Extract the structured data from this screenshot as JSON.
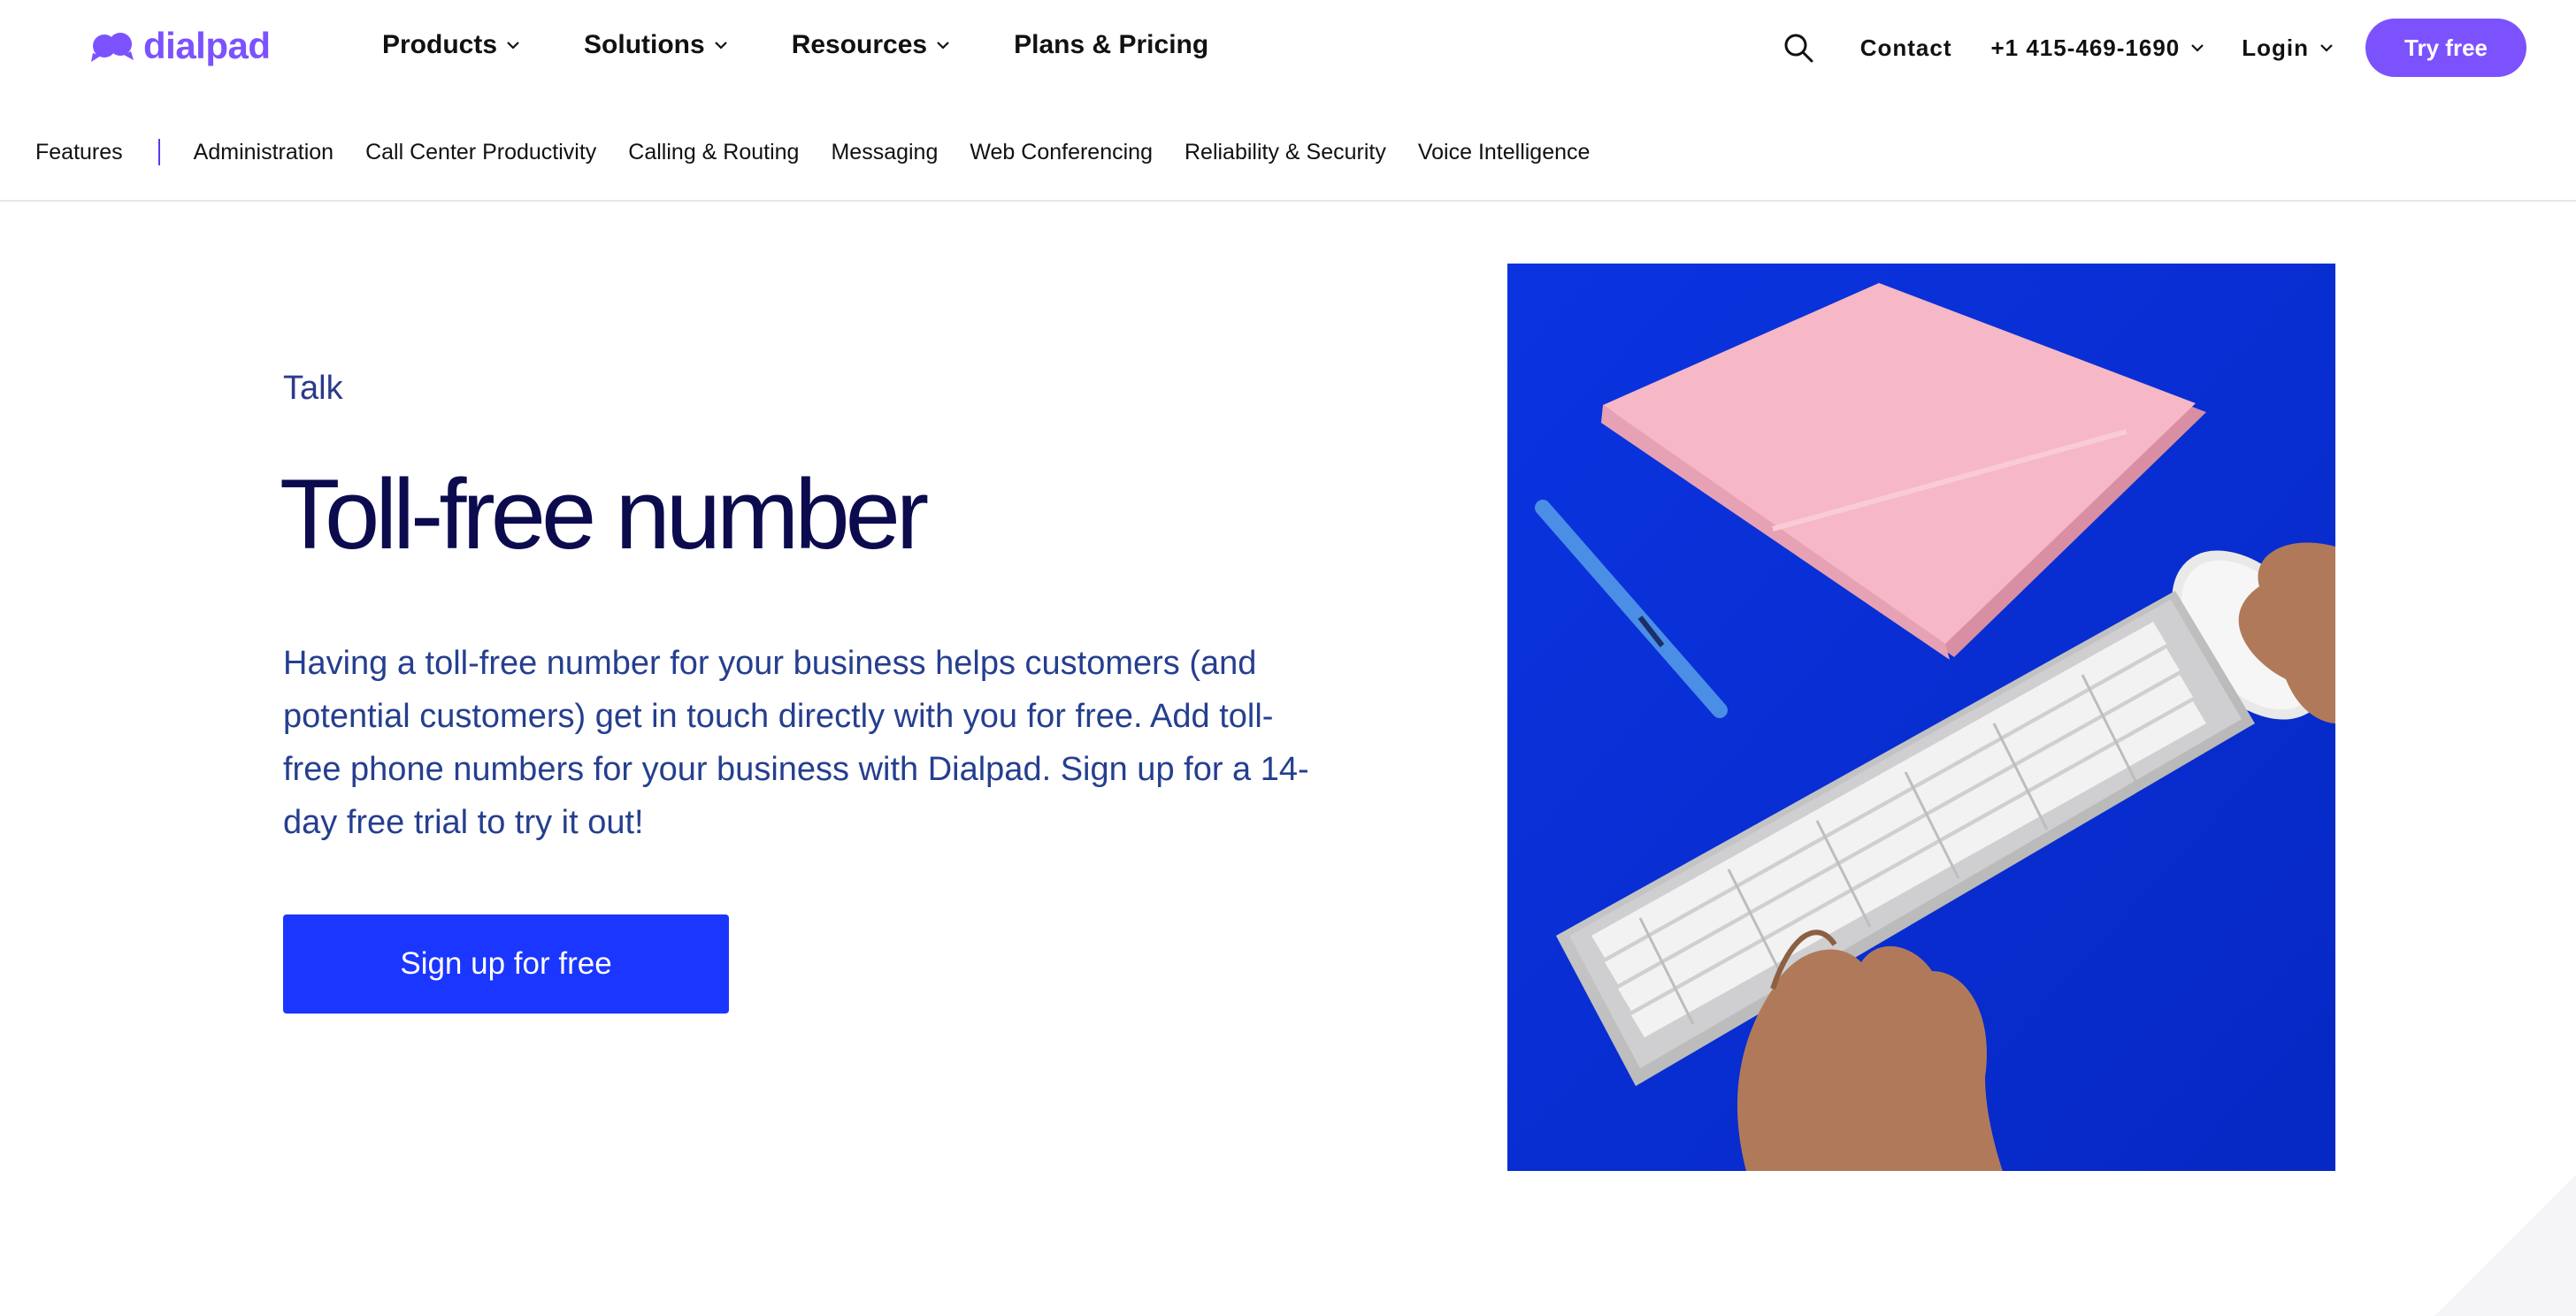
{
  "brand": {
    "name": "dialpad",
    "color": "#7c52ff"
  },
  "topnav": {
    "items": [
      {
        "label": "Products",
        "has_dropdown": true
      },
      {
        "label": "Solutions",
        "has_dropdown": true
      },
      {
        "label": "Resources",
        "has_dropdown": true
      },
      {
        "label": "Plans & Pricing",
        "has_dropdown": false
      }
    ],
    "search_icon": "search-icon",
    "contact": "Contact",
    "phone": "+1 415-469-1690",
    "login": "Login",
    "try_free": "Try free"
  },
  "subnav": {
    "heading": "Features",
    "items": [
      "Administration",
      "Call Center Productivity",
      "Calling & Routing",
      "Messaging",
      "Web Conferencing",
      "Reliability & Security",
      "Voice Intelligence"
    ]
  },
  "hero": {
    "eyebrow": "Talk",
    "title": "Toll-free number",
    "description": "Having a toll-free number for your business helps customers (and potential customers) get in touch directly with you for free. Add toll-free phone numbers for your business with Dialpad. Sign up for a 14-day free trial to try it out!",
    "cta": "Sign up for free",
    "image": "photo of hands typing on a white keyboard next to a pink notebook, pen and mouse on blue background"
  },
  "colors": {
    "accent": "#7c52ff",
    "cta": "#1a36ff",
    "text_dark": "#0b0b4e",
    "text_blue": "#253f8f",
    "image_bg": "#0a2fd6"
  }
}
